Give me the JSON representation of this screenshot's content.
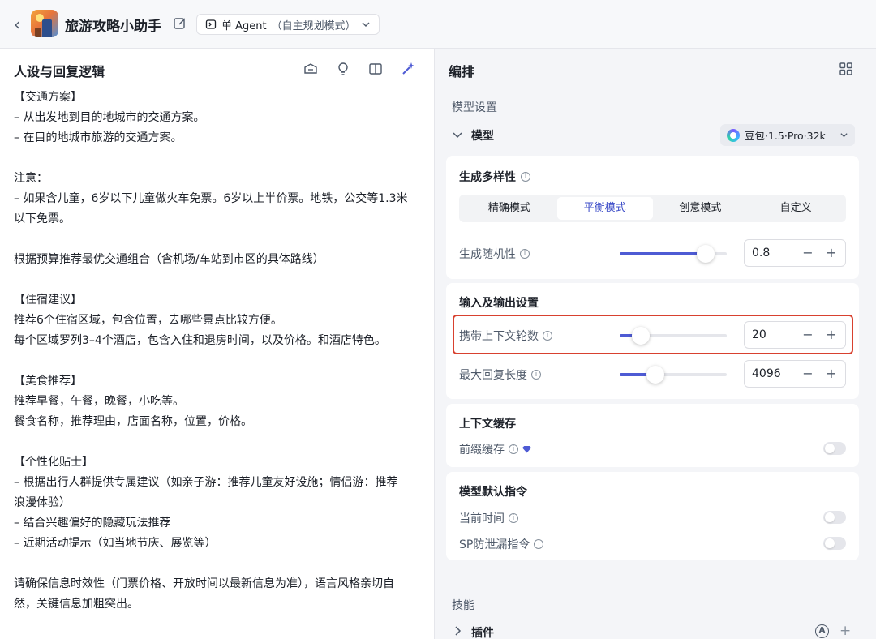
{
  "header": {
    "back_glyph": "‹",
    "app_title": "旅游攻略小助手",
    "mode_prefix": "单 Agent",
    "mode_sub": "（自主规划模式）"
  },
  "left": {
    "title": "人设与回复逻辑",
    "prompt_lines": [
      "【交通方案】",
      "– 从出发地到目的地城市的交通方案。",
      "– 在目的地城市旅游的交通方案。",
      "",
      "注意：",
      "– 如果含儿童，6岁以下儿童做火车免票。6岁以上半价票。地铁，公交等1.3米",
      "以下免票。",
      "",
      "根据预算推荐最优交通组合（含机场/车站到市区的具体路线）",
      "",
      "【住宿建议】",
      "推荐6个住宿区域，包含位置，去哪些景点比较方便。",
      "每个区域罗列3–4个酒店，包含入住和退房时间，以及价格。和酒店特色。",
      "",
      "【美食推荐】",
      "推荐早餐，午餐，晚餐，小吃等。",
      "餐食名称，推荐理由，店面名称，位置，价格。",
      "",
      "【个性化贴士】",
      "– 根据出行人群提供专属建议（如亲子游：推荐儿童友好设施；情侣游：推荐",
      "浪漫体验）",
      "– 结合兴趣偏好的隐藏玩法推荐",
      "– 近期活动提示（如当地节庆、展览等）",
      "",
      "请确保信息时效性（门票价格、开放时间以最新信息为准），语言风格亲切自",
      "然，关键信息加粗突出。"
    ]
  },
  "right": {
    "title": "编排",
    "model_settings_label": "模型设置",
    "model_label": "模型",
    "model_name": "豆包·1.5·Pro·32k",
    "diversity": {
      "title": "生成多样性",
      "modes": [
        "精确模式",
        "平衡模式",
        "创意模式",
        "自定义"
      ],
      "active_mode": "平衡模式",
      "randomness_label": "生成随机性",
      "randomness_value": "0.8",
      "randomness_fraction": 0.8
    },
    "io": {
      "title": "输入及输出设置",
      "context_rounds_label": "携带上下文轮数",
      "context_rounds_value": "20",
      "context_rounds_fraction": 0.2,
      "max_reply_label": "最大回复长度",
      "max_reply_value": "4096",
      "max_reply_fraction": 0.33
    },
    "cache": {
      "title": "上下文缓存",
      "prefix_cache_label": "前缀缓存",
      "prefix_cache_on": false
    },
    "default_instructions": {
      "title": "模型默认指令",
      "current_time_label": "当前时间",
      "current_time_on": false,
      "sp_leak_label": "SP防泄漏指令",
      "sp_leak_on": false
    },
    "skills_label": "技能",
    "plugins_label": "插件",
    "auto_glyph": "A",
    "stepper_minus": "−",
    "stepper_plus": "+",
    "add_glyph": "+",
    "info_glyph": "i"
  },
  "colors": {
    "accent": "#4e5bd4",
    "highlight": "#d8412f"
  }
}
